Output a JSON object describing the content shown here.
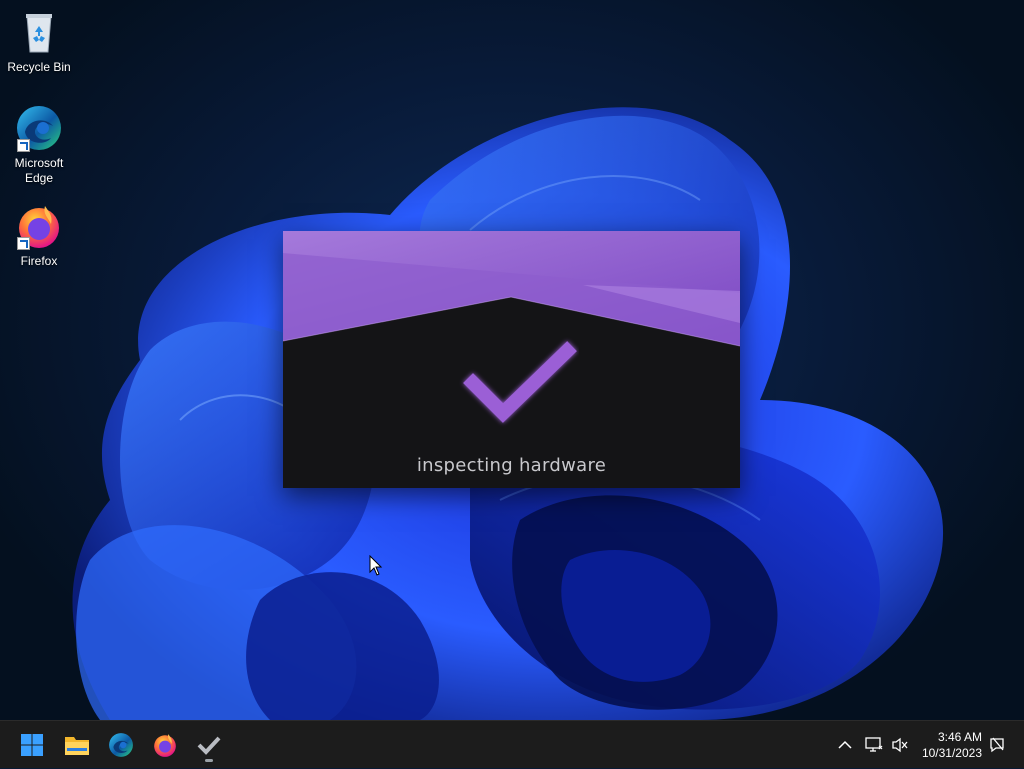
{
  "desktop": {
    "icons": [
      {
        "label": "Recycle Bin",
        "icon": "recycle-bin-icon"
      },
      {
        "label": "Microsoft Edge",
        "icon": "edge-icon"
      },
      {
        "label": "Firefox",
        "icon": "firefox-icon"
      }
    ]
  },
  "splash": {
    "status_text": "inspecting hardware",
    "icon": "checkmark-icon",
    "accent_color": "#9b5fd6"
  },
  "taskbar": {
    "pinned": [
      {
        "name": "Start",
        "icon": "windows-start-icon"
      },
      {
        "name": "File Explorer",
        "icon": "folder-icon"
      },
      {
        "name": "Microsoft Edge",
        "icon": "edge-icon"
      },
      {
        "name": "Firefox",
        "icon": "firefox-icon"
      },
      {
        "name": "Installer",
        "icon": "checkmark-icon",
        "running": true
      }
    ],
    "tray": {
      "icons": [
        "chevron-up-icon",
        "network-icon",
        "volume-muted-icon",
        "notification-icon"
      ],
      "time": "3:46 AM",
      "date": "10/31/2023"
    }
  }
}
